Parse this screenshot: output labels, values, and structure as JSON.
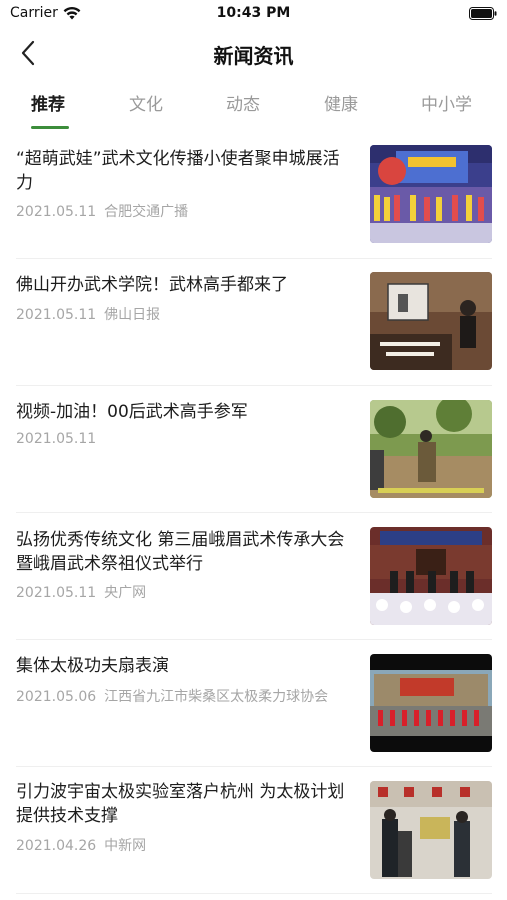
{
  "status_bar": {
    "carrier": "Carrier",
    "time": "10:43 PM"
  },
  "nav": {
    "title": "新闻资讯"
  },
  "tabs": [
    {
      "label": "推荐",
      "active": true
    },
    {
      "label": "文化",
      "active": false
    },
    {
      "label": "动态",
      "active": false
    },
    {
      "label": "健康",
      "active": false
    },
    {
      "label": "中小学",
      "active": false
    }
  ],
  "colors": {
    "accent": "#3c8d3b",
    "meta": "#a6a6a6"
  },
  "news": [
    {
      "title": "“超萌武娃”武术文化传播小使者聚申城展活力",
      "date": "2021.05.11",
      "source": "合肥交通广播",
      "thumb": "stage-performance-photo"
    },
    {
      "title": "佛山开办武术学院！武林高手都来了",
      "date": "2021.05.11",
      "source": "佛山日报",
      "thumb": "lecture-speaker-photo"
    },
    {
      "title": "视频-加油！00后武术高手参军",
      "date": "2021.05.11",
      "source": "",
      "thumb": "outdoor-soldier-photo"
    },
    {
      "title": "弘扬优秀传统文化 第三届峨眉武术传承大会暨峨眉武术祭祖仪式举行",
      "date": "2021.05.11",
      "source": "央广网",
      "thumb": "ceremony-hall-photo"
    },
    {
      "title": "集体太极功夫扇表演",
      "date": "2021.05.06",
      "source": "江西省九江市柴桑区太极柔力球协会",
      "thumb": "fan-performance-video"
    },
    {
      "title": "引力波宇宙太极实验室落户杭州 为太极计划提供技术支撑",
      "date": "2021.04.26",
      "source": "中新网",
      "thumb": "plaque-unveiling-photo"
    }
  ]
}
